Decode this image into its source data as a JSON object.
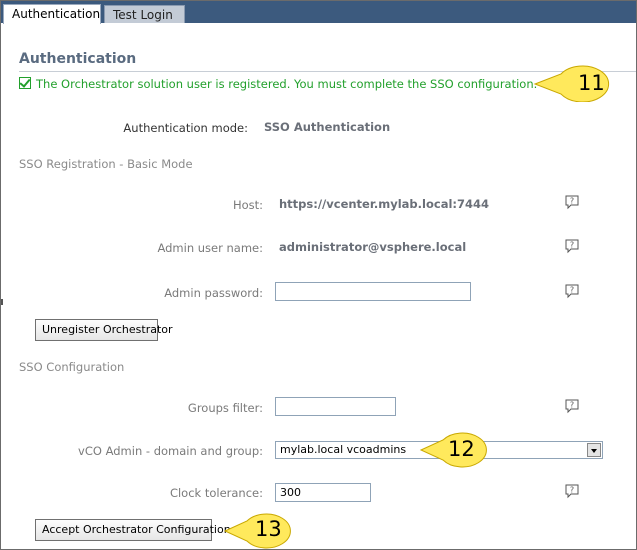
{
  "tabs": [
    {
      "label": "Authentication",
      "active": true
    },
    {
      "label": "Test Login",
      "active": false
    }
  ],
  "page_title": "Authentication",
  "status_message": "The Orchestrator solution user is registered. You must complete the SSO configuration.",
  "auth_mode": {
    "label": "Authentication mode:",
    "value": "SSO Authentication"
  },
  "sso_registration": {
    "heading": "SSO Registration - Basic Mode",
    "host": {
      "label": "Host:",
      "value": "https://vcenter.mylab.local:7444"
    },
    "admin_user": {
      "label": "Admin user name:",
      "value": "administrator@vsphere.local"
    },
    "admin_password": {
      "label": "Admin password:",
      "value": ""
    },
    "unregister_button": "Unregister Orchestrator"
  },
  "sso_configuration": {
    "heading": "SSO Configuration",
    "groups_filter": {
      "label": "Groups filter:",
      "value": ""
    },
    "vco_admin": {
      "label": "vCO Admin - domain and group:",
      "selected": "mylab.local vcoadmins"
    },
    "clock_tolerance": {
      "label": "Clock tolerance:",
      "value": "300"
    },
    "accept_button": "Accept Orchestrator Configuration"
  },
  "callouts": [
    "11",
    "12",
    "13"
  ],
  "colors": {
    "tab_bar": "#3c5a7e",
    "status_green": "#22a02c",
    "callout_fill": "#ffe95c",
    "title_color": "#5a6b80"
  }
}
